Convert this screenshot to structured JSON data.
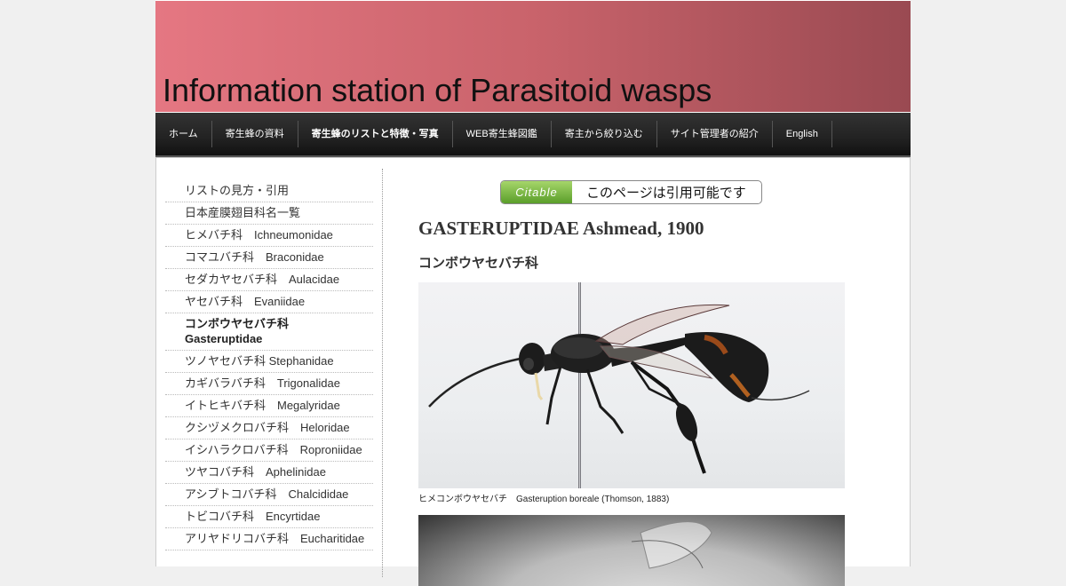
{
  "site": {
    "title": "Information station of Parasitoid wasps"
  },
  "nav": {
    "items": [
      {
        "label": "ホーム",
        "active": false
      },
      {
        "label": "寄生蜂の資料",
        "active": false
      },
      {
        "label": "寄生蜂のリストと特徴・写真",
        "active": true
      },
      {
        "label": "WEB寄生蜂図鑑",
        "active": false
      },
      {
        "label": "寄主から絞り込む",
        "active": false
      },
      {
        "label": "サイト管理者の紹介",
        "active": false
      },
      {
        "label": "English",
        "active": false
      }
    ]
  },
  "sidebar": {
    "items": [
      {
        "label": "リストの見方・引用"
      },
      {
        "label": "日本産膜翅目科名一覧"
      },
      {
        "label": "ヒメバチ科　Ichneumonidae"
      },
      {
        "label": "コマユバチ科　Braconidae"
      },
      {
        "label": "セダカヤセバチ科　Aulacidae"
      },
      {
        "label": "ヤセバチ科　Evaniidae"
      },
      {
        "label": "コンボウヤセバチ科　Gasteruptidae",
        "active": true
      },
      {
        "label": "ツノヤセバチ科 Stephanidae"
      },
      {
        "label": "カギバラバチ科　Trigonalidae"
      },
      {
        "label": "イトヒキバチ科　Megalyridae"
      },
      {
        "label": "クシヅメクロバチ科　Heloridae"
      },
      {
        "label": "イシハラクロバチ科　Roproniidae"
      },
      {
        "label": "ツヤコバチ科　Aphelinidae"
      },
      {
        "label": "アシブトコバチ科　Chalcididae"
      },
      {
        "label": "トビコバチ科　Encyrtidae"
      },
      {
        "label": "アリヤドリコバチ科　Eucharitidae"
      }
    ]
  },
  "main": {
    "citable_tag": "Citable",
    "citable_text": "このページは引用可能です",
    "family_title": "GASTERUPTIDAE Ashmead, 1900",
    "family_jp": "コンボウヤセバチ科",
    "photo1_caption": "ヒメコンボウヤセバチ　Gasteruption boreale (Thomson, 1883)"
  },
  "colors": {
    "banner_left": "#e57782",
    "banner_right": "#9a4a52",
    "nav_bg": "#222222",
    "citable_green": "#6aae32"
  }
}
